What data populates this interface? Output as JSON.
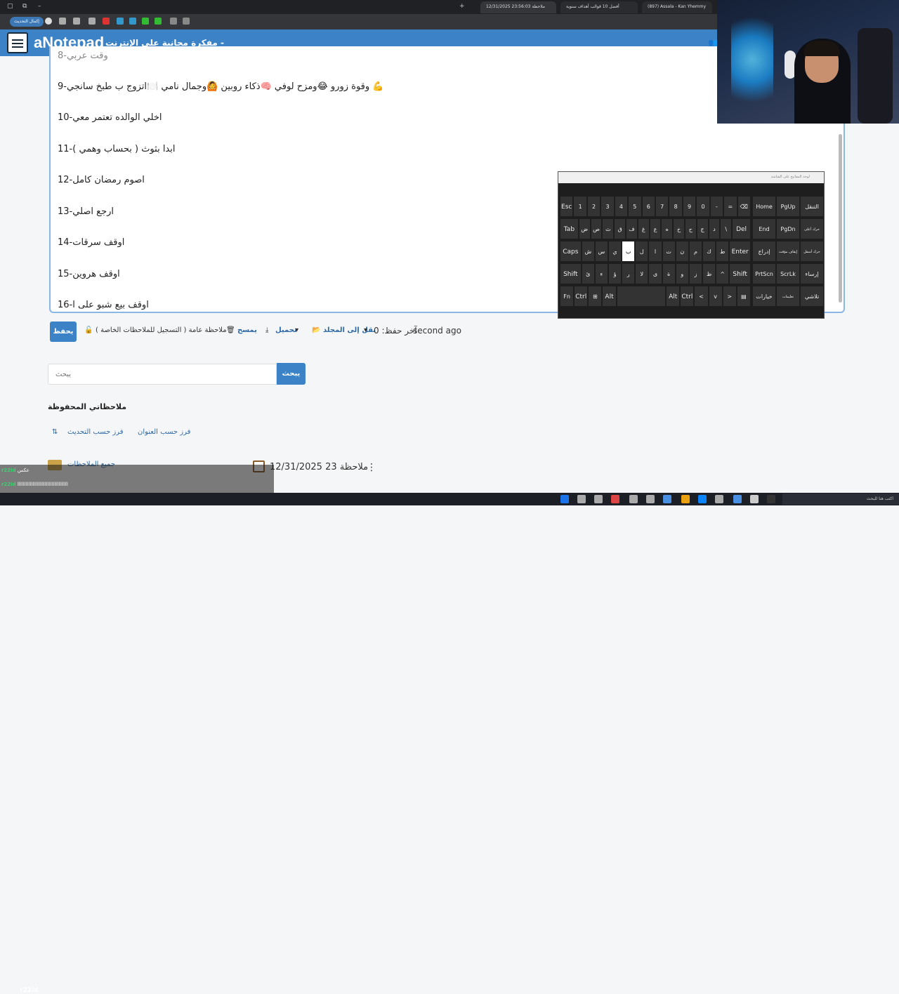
{
  "browser": {
    "tabs": [
      {
        "label": "ملاحظة 23:56:03 12/31/2025",
        "active": true
      },
      {
        "label": "أفضل 10 قوالب أهداف سنوية",
        "active": false
      },
      {
        "label": "(897) Assala - Kan Yhemmy",
        "active": false
      }
    ],
    "update_button": "إكمال التحديث"
  },
  "header": {
    "brand": "aNotepad",
    "subtitle": "مفكرة مجانية على الإنترنت -"
  },
  "note_lines": [
    "وقت عربي-8",
    "9-وقوة زورو 😂ومزح لوفي 🧠ذكاء روبين 🙆وجمال نامي 🍽️اتزوج ب طبخ سانجي 💪",
    "10-اخلي الوالده تعتمر معي",
    "11-( ابدا بثوث ( بحساب وهمي",
    "12-اصوم رمضان كامل",
    "13-ارجع اصلي",
    "14-اوقف سرقات",
    "15-اوقف هروين",
    "16-اوقف بيع شبو على ا"
  ],
  "actions": {
    "save": "يحفظ",
    "public_note": "ملاحظة عامة ( التسجيل للملاحظات الخاصة )",
    "delete": "يمسح",
    "download": "تحميل",
    "move_to_folder": "نقل إلى المجلد",
    "last_saved_label": "آخر حفظ: 0",
    "last_saved_value": "second ago"
  },
  "search": {
    "placeholder": "يبحث",
    "button": "يبحث"
  },
  "saved_notes": {
    "title": "ملاحظاتي المحفوظة",
    "sort_title": "فرز حسب العنوان",
    "sort_update": "فرز حسب التحديث",
    "folder": "جميع الملاحظات",
    "note_item": "ملاحظة 23 12/31/2025"
  },
  "keyboard": {
    "title": "لوحة المفاتيح على الشاشة",
    "row1": [
      "Esc",
      "1",
      "2",
      "3",
      "4",
      "5",
      "6",
      "7",
      "8",
      "9",
      "0",
      "-",
      "=",
      "⌫"
    ],
    "row2": [
      "Tab",
      "ض",
      "ص",
      "ث",
      "ق",
      "ف",
      "غ",
      "ع",
      "ه",
      "خ",
      "ح",
      "ج",
      "د",
      "\\",
      "Del"
    ],
    "row3": [
      "Caps",
      "ش",
      "س",
      "ي",
      "ب",
      "ل",
      "ا",
      "ت",
      "ن",
      "م",
      "ك",
      "ط",
      "Enter"
    ],
    "row4": [
      "Shift",
      "ئ",
      "ء",
      "ؤ",
      "ر",
      "لا",
      "ى",
      "ة",
      "و",
      "ز",
      "ظ",
      "^",
      "Shift"
    ],
    "row5": [
      "Fn",
      "Ctrl",
      "⊞",
      "Alt",
      "",
      "Alt",
      "Ctrl",
      "<",
      "v",
      ">",
      "▤"
    ],
    "side": [
      [
        "Home",
        "PgUp",
        "التنقل"
      ],
      [
        "End",
        "PgDn",
        "حرك أعلى"
      ],
      [
        "إدراج",
        "إيقاف مؤقت",
        "حرك أسفل"
      ],
      [
        "PrtScn",
        "ScrLk",
        "إرساء"
      ],
      [
        "خيارات",
        "تعليمات",
        "تلاشي"
      ]
    ]
  },
  "chat": [
    {
      "name": "r22id",
      "text": "عكس"
    },
    {
      "name": "r22id",
      "text": "ااااااااااااااااااااااااااااااااااااا"
    }
  ],
  "tray_user": "r22id",
  "taskbar_search": "اكتب هنا للبحث"
}
